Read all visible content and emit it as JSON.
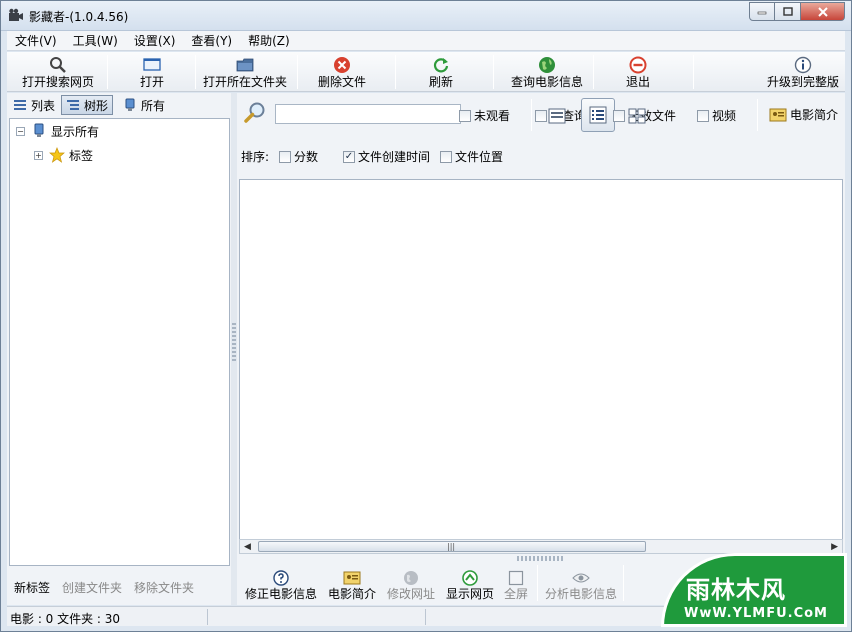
{
  "window": {
    "title": "影藏者-(1.0.4.56)"
  },
  "menu": [
    "文件(V)",
    "工具(W)",
    "设置(X)",
    "查看(Y)",
    "帮助(Z)"
  ],
  "toolbar": {
    "open_search_page": "打开搜索网页",
    "open": "打开",
    "open_folder": "打开所在文件夹",
    "delete_file": "删除文件",
    "refresh": "刷新",
    "query_movie_info": "查询电影信息",
    "exit": "退出",
    "upgrade": "升级到完整版"
  },
  "left": {
    "tabs": {
      "list": "列表",
      "tree": "树形",
      "all": "所有"
    },
    "tree": {
      "show_all": "显示所有",
      "tags": "标签"
    },
    "bottom": {
      "new_tag": "新标签",
      "create_folder": "创建文件夹",
      "remove_folder": "移除文件夹"
    }
  },
  "search": {
    "value": "",
    "filters": {
      "unwatched": "未观看",
      "unqueried": "未查询",
      "invalid_file": "无效文件",
      "video": "视频",
      "movie_intro": "电影简介"
    }
  },
  "sort": {
    "label": "排序:",
    "options": {
      "score": "分数",
      "created_time": "文件创建时间",
      "location": "文件位置"
    },
    "created_time_checked": true
  },
  "bottom_toolbar": {
    "fix_info": "修正电影信息",
    "movie_intro": "电影简介",
    "edit_url": "修改网址",
    "show_page": "显示网页",
    "fullscreen": "全屏",
    "analyze_info": "分析电影信息"
  },
  "status": {
    "text": "电影 : 0 文件夹 : 30"
  },
  "watermark": {
    "title": "雨林木风",
    "url": "WwW.YLMFU.CoM"
  },
  "colors": {
    "accent_green": "#1f9a3c",
    "delete_red": "#d8412f",
    "close_red": "#c7453a"
  }
}
